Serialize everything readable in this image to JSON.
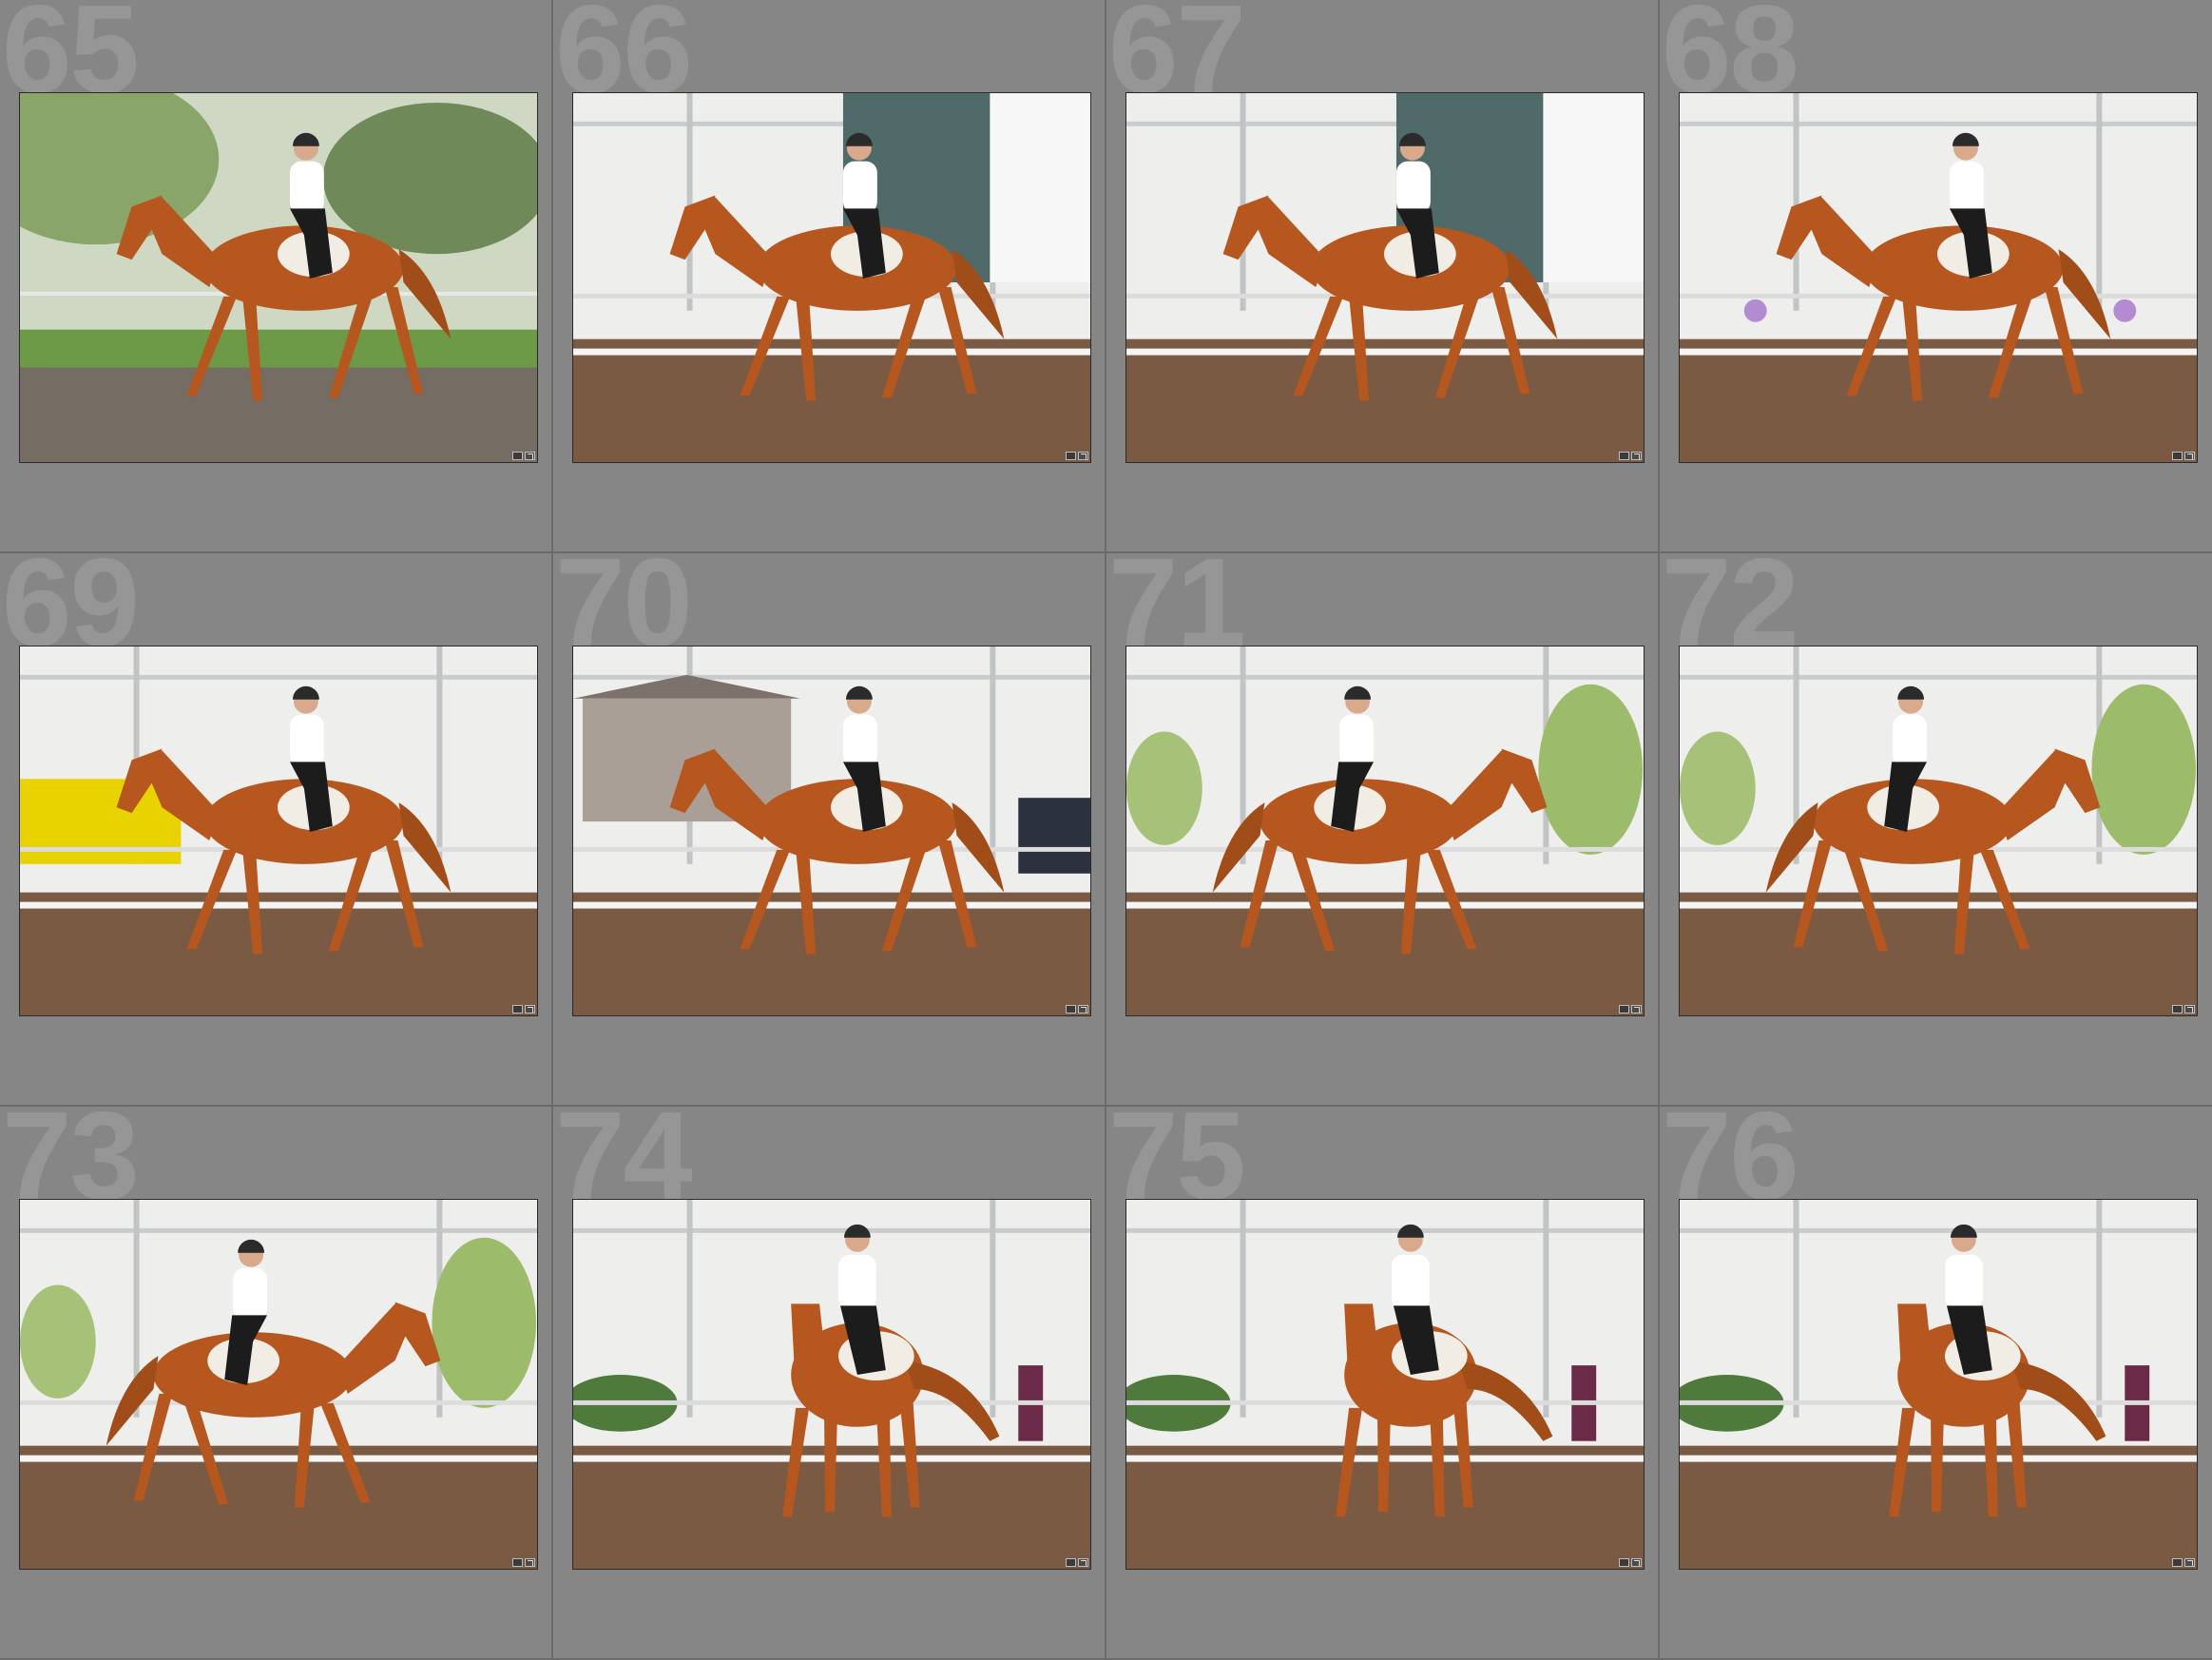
{
  "grid": {
    "cells": [
      {
        "number": "65",
        "scene": "outdoor",
        "direction": "left"
      },
      {
        "number": "66",
        "scene": "arena-barn",
        "direction": "left"
      },
      {
        "number": "67",
        "scene": "arena-barn",
        "direction": "left"
      },
      {
        "number": "68",
        "scene": "arena-flowers",
        "direction": "left"
      },
      {
        "number": "69",
        "scene": "arena-trailer",
        "direction": "left"
      },
      {
        "number": "70",
        "scene": "arena-booth",
        "direction": "left"
      },
      {
        "number": "71",
        "scene": "arena-trees",
        "direction": "right"
      },
      {
        "number": "72",
        "scene": "arena-trees",
        "direction": "right"
      },
      {
        "number": "73",
        "scene": "arena-trees",
        "direction": "right"
      },
      {
        "number": "74",
        "scene": "arena-hedge",
        "direction": "front"
      },
      {
        "number": "75",
        "scene": "arena-hedge",
        "direction": "front"
      },
      {
        "number": "76",
        "scene": "arena-hedge",
        "direction": "front"
      }
    ]
  },
  "colors": {
    "cell_bg": "#868686",
    "number_color": "#969696",
    "horse": "#b5571f",
    "dirt": "#7a5a42"
  },
  "icons": {
    "badge_left": "metadata-badge-icon",
    "badge_right": "edit-badge-icon"
  }
}
